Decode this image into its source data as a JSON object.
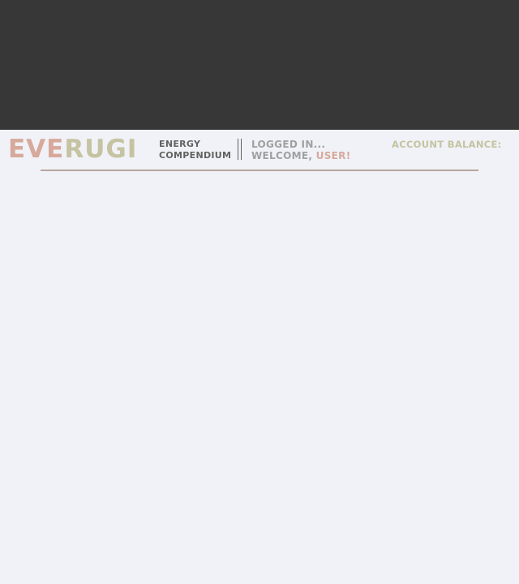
{
  "header": {
    "logo": {
      "part_a": "EVE",
      "part_b": "RUGI"
    },
    "tagline": {
      "line1": "ENERGY",
      "line2": "COMPENDIUM"
    },
    "status": {
      "line1": "LOGGED IN...",
      "welcome_prefix": "WELCOME, ",
      "user": "USER!"
    },
    "balance_label": "ACCOUNT BALANCE:"
  },
  "colors": {
    "top_band": "#373737",
    "page_background": "#f0f2f7",
    "logo_a": "#d7a99b",
    "logo_b": "#c5c3a1",
    "accent_rule": "#b9a79c",
    "muted_text": "#a0a0a0",
    "dark_text": "#616161"
  }
}
